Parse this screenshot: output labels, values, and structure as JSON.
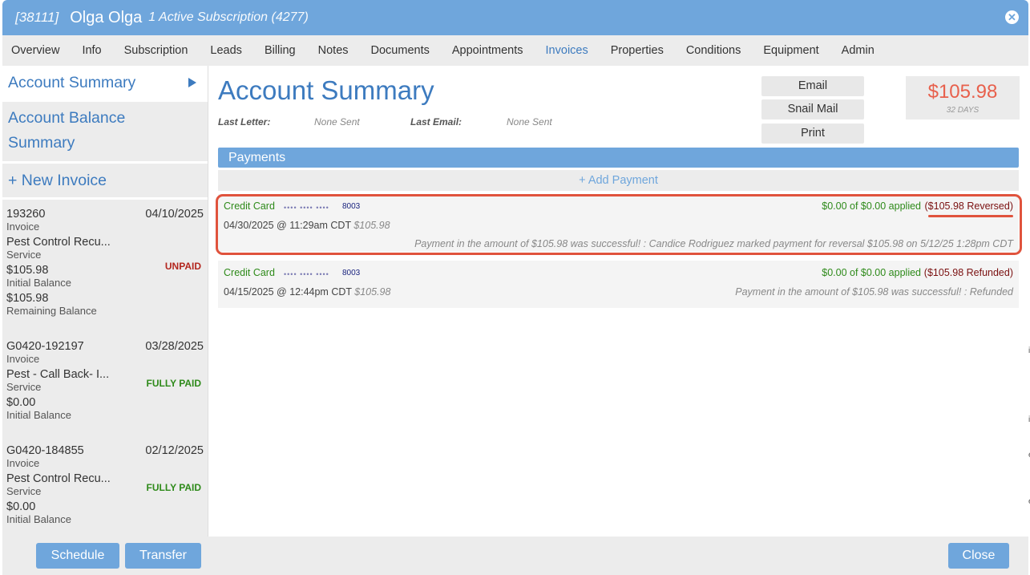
{
  "title": {
    "account_id": "[38111]",
    "customer_name": "Olga Olga",
    "subscription_info": "1 Active Subscription (4277)"
  },
  "tabs": [
    {
      "label": "Overview"
    },
    {
      "label": "Info"
    },
    {
      "label": "Subscription"
    },
    {
      "label": "Leads"
    },
    {
      "label": "Billing"
    },
    {
      "label": "Notes"
    },
    {
      "label": "Documents"
    },
    {
      "label": "Appointments"
    },
    {
      "label": "Invoices",
      "active": true
    },
    {
      "label": "Properties"
    },
    {
      "label": "Conditions"
    },
    {
      "label": "Equipment"
    },
    {
      "label": "Admin"
    }
  ],
  "sidebar": {
    "account_summary": "Account Summary",
    "account_balance_line1": "Account Balance",
    "account_balance_line2": "Summary",
    "new_invoice": "+ New Invoice",
    "invoices": [
      {
        "number": "193260",
        "date": "04/10/2025",
        "type": "Invoice",
        "service": "Pest Control Recu...",
        "service_label": "Service",
        "status": "UNPAID",
        "amount1": "$105.98",
        "amount1_label": "Initial Balance",
        "amount2": "$105.98",
        "amount2_label": "Remaining Balance"
      },
      {
        "number": "G0420-192197",
        "date": "03/28/2025",
        "type": "Invoice",
        "service": "Pest - Call Back- I...",
        "service_label": "Service",
        "status": "FULLY PAID",
        "amount1": "$0.00",
        "amount1_label": "Initial Balance"
      },
      {
        "number": "G0420-184855",
        "date": "02/12/2025",
        "type": "Invoice",
        "service": "Pest Control Recu...",
        "service_label": "Service",
        "status": "FULLY PAID",
        "amount1": "$0.00",
        "amount1_label": "Initial Balance"
      }
    ]
  },
  "main": {
    "title": "Account Summary",
    "last_letter_label": "Last Letter:",
    "last_letter_value": "None Sent",
    "last_email_label": "Last Email:",
    "last_email_value": "None Sent",
    "buttons": {
      "email": "Email",
      "snail_mail": "Snail Mail",
      "print": "Print"
    },
    "balance": {
      "amount": "$105.98",
      "days": "32 DAYS"
    },
    "payments_header": "Payments",
    "add_payment": "+ Add Payment",
    "payments": [
      {
        "type": "Credit Card",
        "masked": "•••• •••• ••••",
        "last4": "8003",
        "applied": "$0.00 of $0.00 applied",
        "status": "($105.98 Reversed)",
        "datetime": "04/30/2025 @ 11:29am CDT",
        "amount": "$105.98",
        "note": "Payment in the amount of $105.98 was successful! : Candice Rodriguez marked payment for reversal $105.98 on 5/12/25 1:28pm CDT"
      },
      {
        "type": "Credit Card",
        "masked": "•••• •••• ••••",
        "last4": "8003",
        "applied": "$0.00 of $0.00 applied",
        "status": "($105.98 Refunded)",
        "datetime": "04/15/2025 @ 12:44pm CDT",
        "amount": "$105.98",
        "note": "Payment in the amount of $105.98 was successful! : Refunded"
      }
    ]
  },
  "footer": {
    "schedule": "Schedule",
    "transfer": "Transfer",
    "close": "Close"
  },
  "edge_marks": [
    "i",
    "i",
    "e",
    "e"
  ],
  "colors": {
    "header_blue": "#6fa6dc",
    "link_blue": "#3d7bbf",
    "balance_red": "#e8604c",
    "paid_green": "#2e8a1a",
    "unpaid_red": "#b3261e",
    "highlight_red": "#e0533d"
  }
}
